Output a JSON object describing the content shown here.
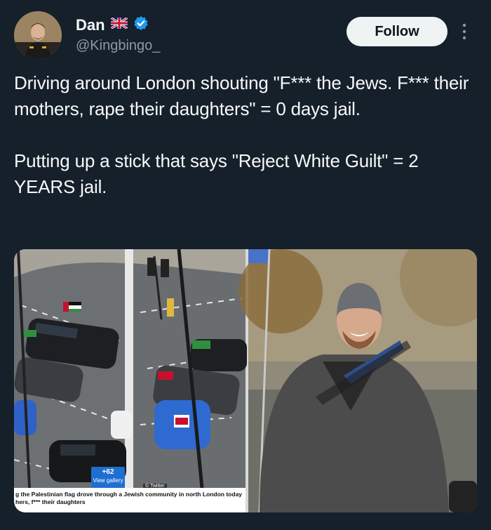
{
  "author": {
    "name": "Dan",
    "flag_emoji": "🇬🇧",
    "handle": "@Kingbingo_",
    "verified": true
  },
  "actions": {
    "follow_label": "Follow",
    "more_icon": "more-vertical-icon"
  },
  "tweet": {
    "paragraph_1": "Driving around London shouting \"F*** the Jews. F*** their mothers, rape their daughters\" = 0 days jail.",
    "paragraph_2": "Putting up a stick that says \"Reject White Guilt\" = 2 YEARS jail."
  },
  "media": {
    "gallery_count": "+62",
    "gallery_label": "View gallery",
    "credit": "© Twitter",
    "caption_line_1": "g the Palestinian flag drove through a Jewish community in north London today",
    "caption_line_2": "hers, f*** their daughters"
  },
  "colors": {
    "background": "#15202b",
    "text": "#f7f9f9",
    "secondary_text": "#8b98a5",
    "verified_blue": "#1d9bf0",
    "follow_bg": "#eff3f4"
  }
}
